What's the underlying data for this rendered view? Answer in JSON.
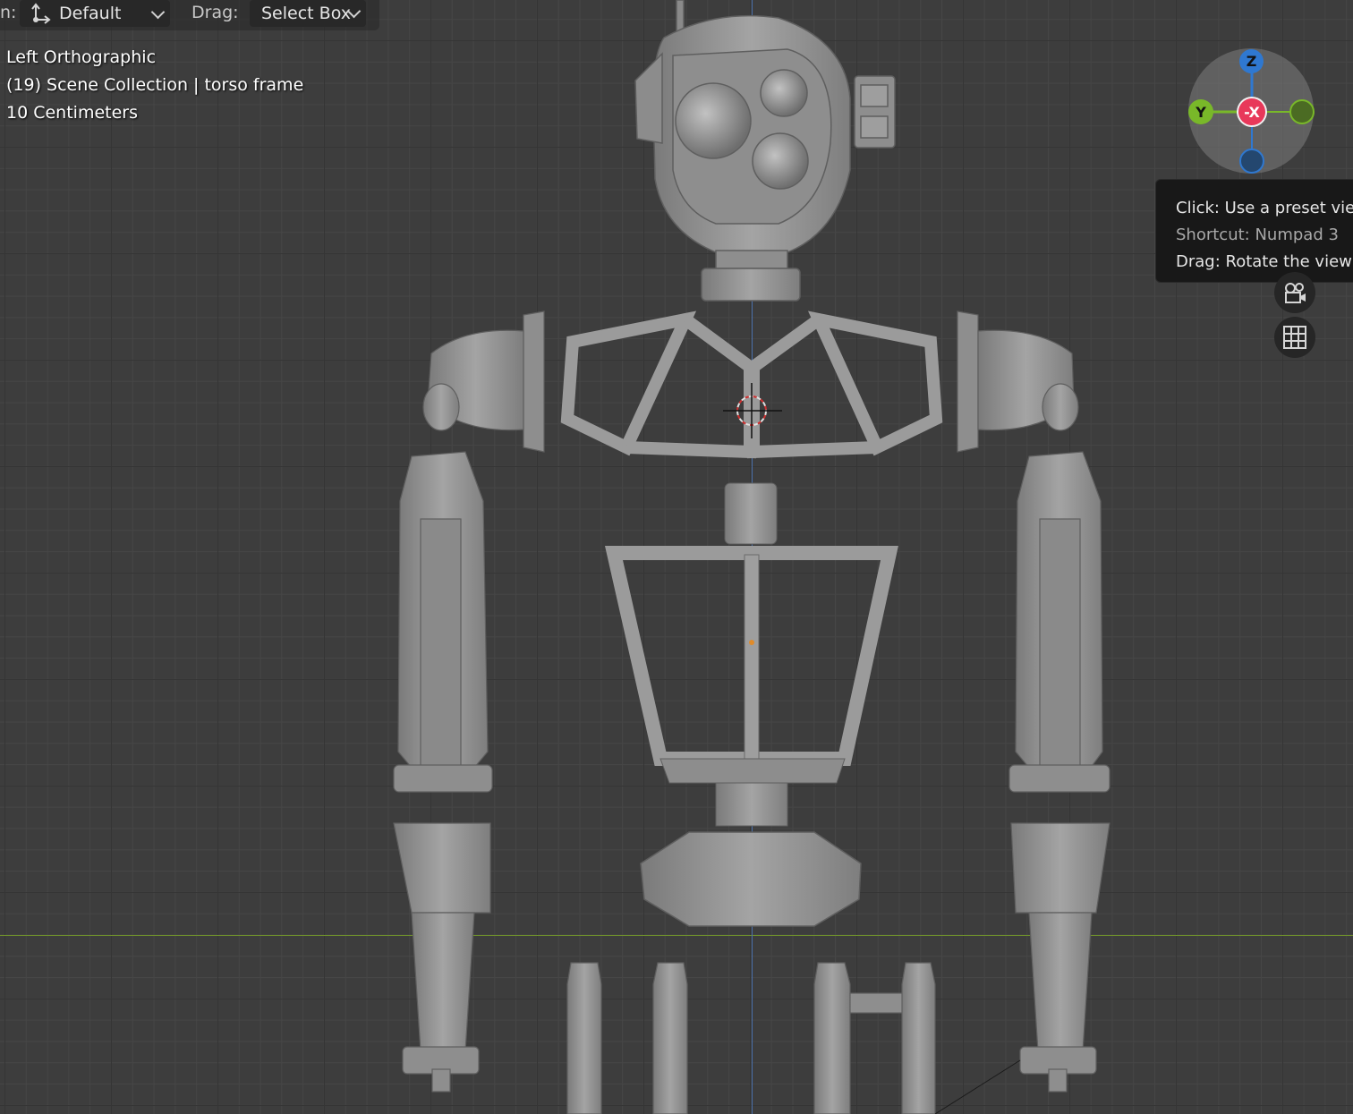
{
  "header": {
    "orientation_label_partial": "n:",
    "orientation_icon": "transform-orientation-icon",
    "orientation_value": "Default",
    "drag_label": "Drag:",
    "drag_value": "Select Box"
  },
  "viewport": {
    "view_name": "Left Orthographic",
    "collection_info": "(19) Scene Collection | torso frame",
    "grid_scale": "10 Centimeters"
  },
  "gizmo": {
    "z_label": "Z",
    "y_label": "Y",
    "x_label": "-X",
    "colors": {
      "z": "#2f78d0",
      "y": "#79b829",
      "x": "#e8385a"
    }
  },
  "tooltip": {
    "click_text": "Click: Use a preset viewpoint",
    "shortcut_text": "Shortcut: Numpad 3",
    "drag_text": "Drag: Rotate the view"
  },
  "navigation": {
    "camera_icon": "camera-view-icon",
    "grid_icon": "ortho-grid-icon"
  },
  "colors": {
    "background": "#3d3d3d",
    "model": "#8f8f8f",
    "axis_x": "#6d8f2c",
    "axis_y": "#4a6fa8"
  }
}
